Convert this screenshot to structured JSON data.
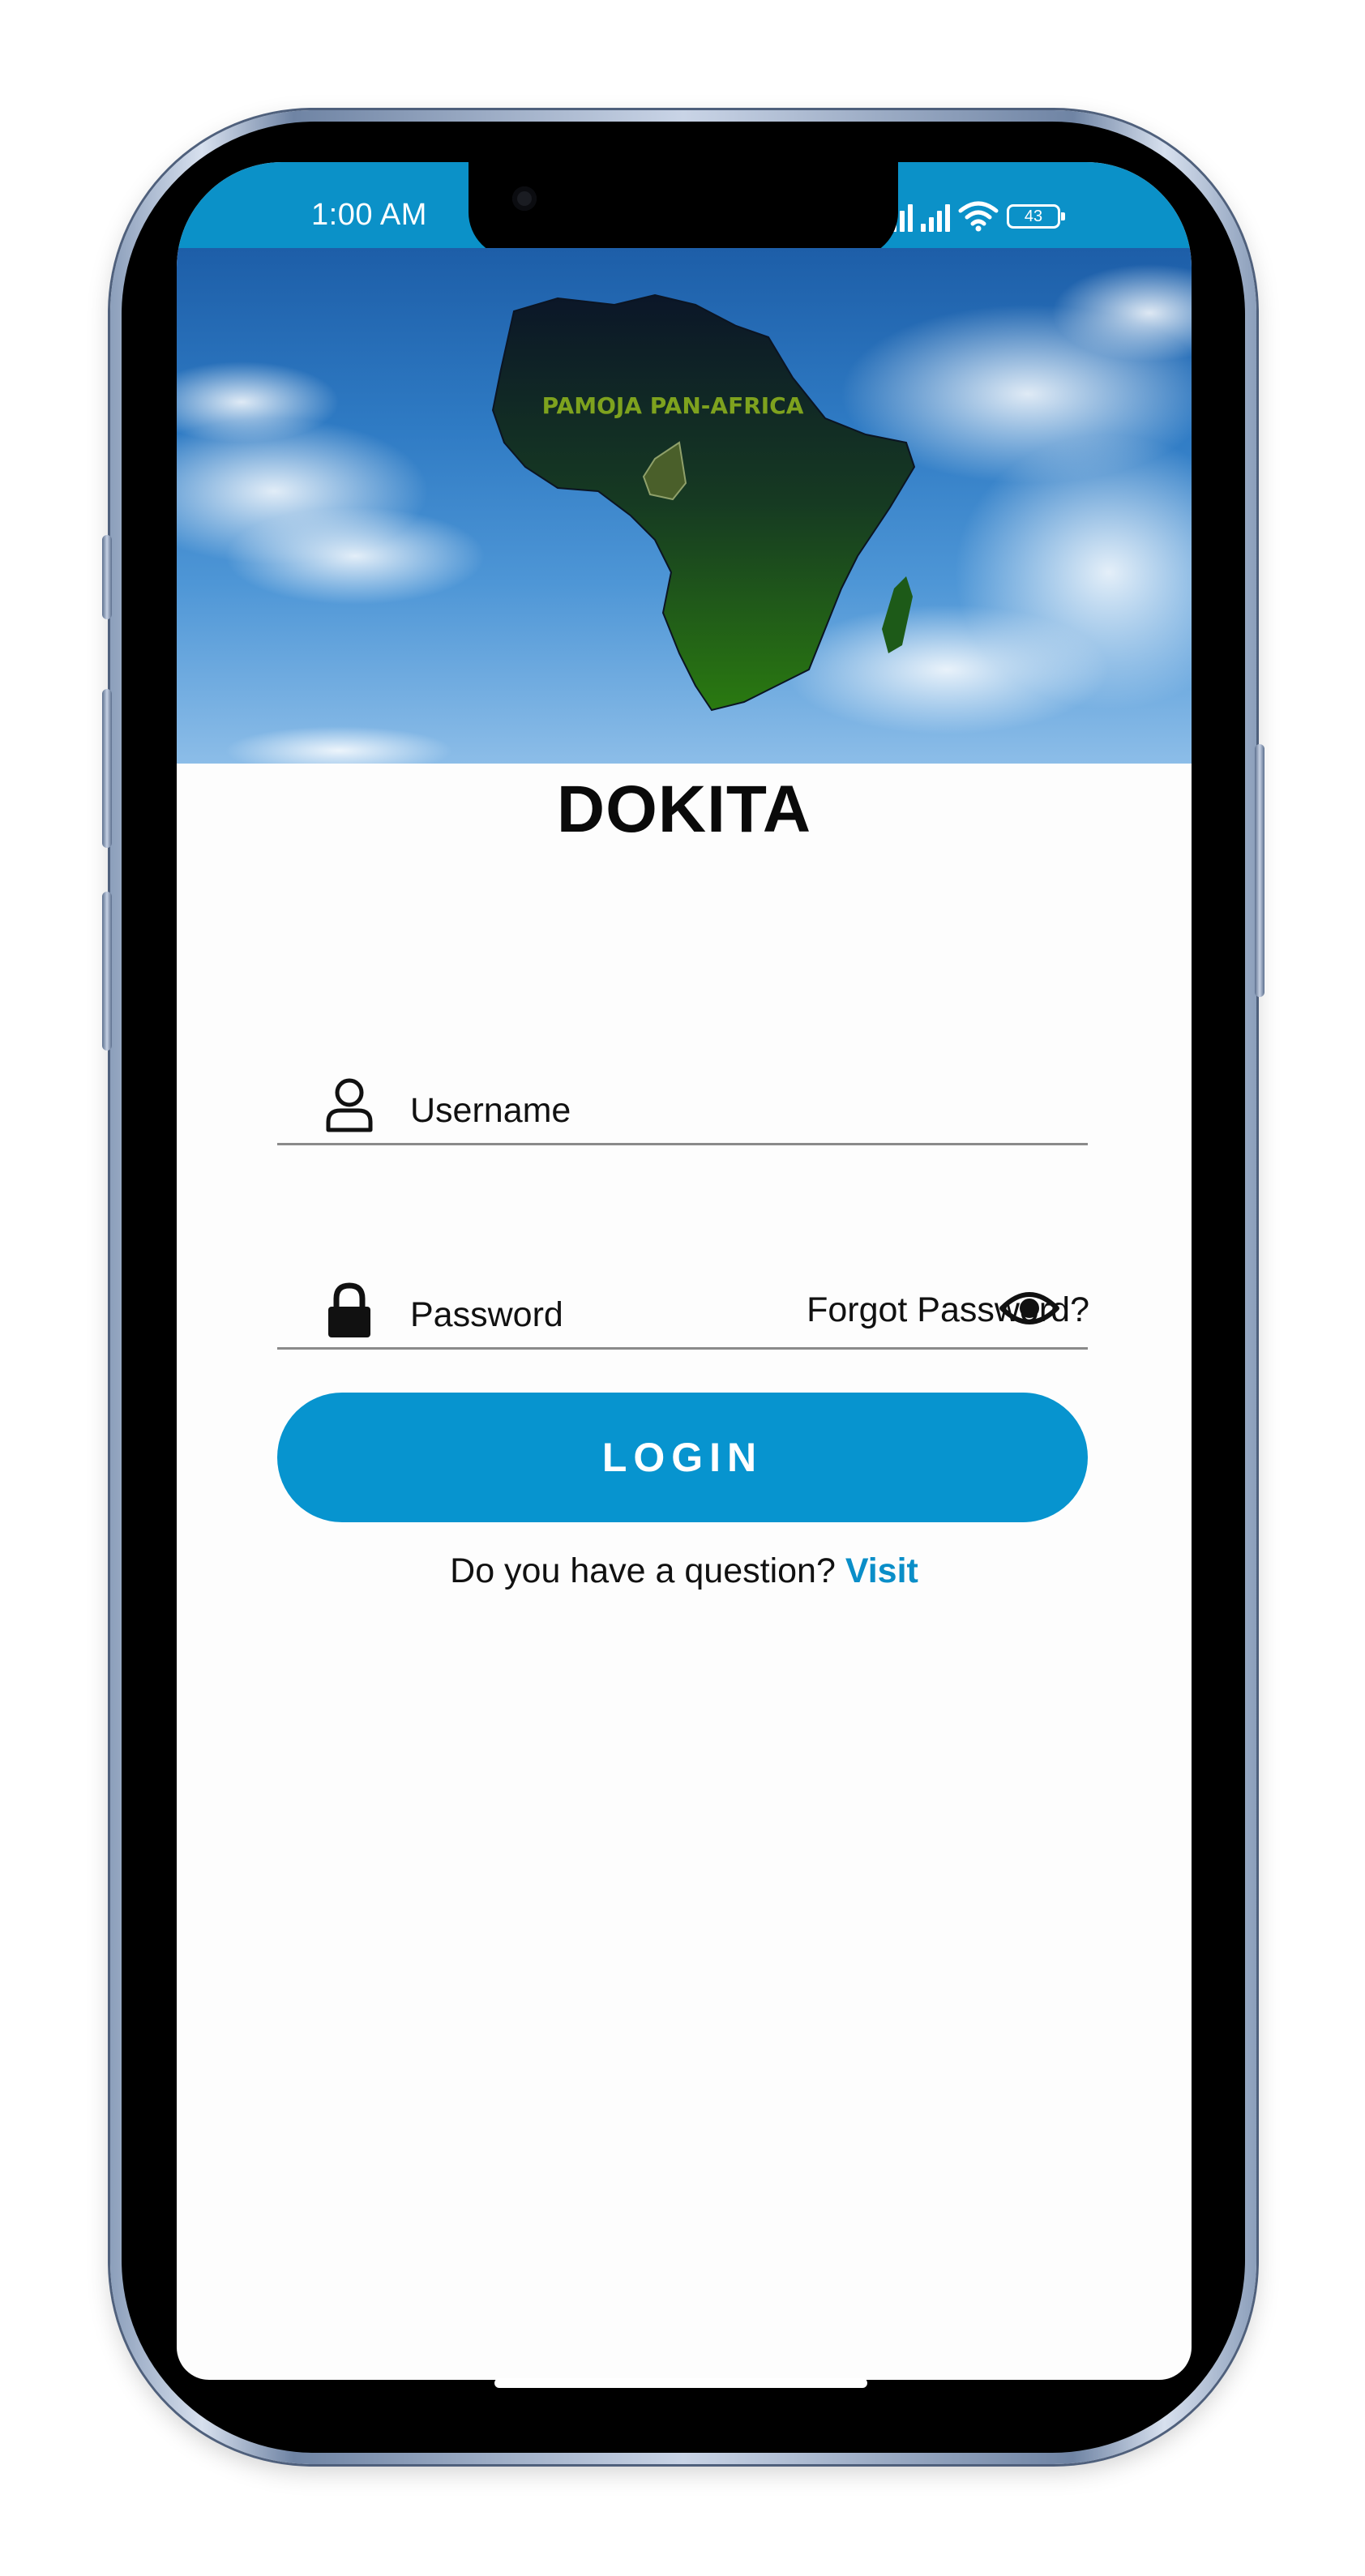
{
  "status_bar": {
    "time": "1:00 AM",
    "battery": "43",
    "icons": [
      "signal-icon",
      "signal-icon",
      "wifi-icon",
      "battery-icon"
    ]
  },
  "hero": {
    "logo_text": "PAMOJA PAN-AFRICA"
  },
  "app_title": "DOKITA",
  "login_form": {
    "username_placeholder": "Username",
    "password_placeholder": "Password",
    "forgot_password": "Forgot Password?",
    "login_button": "LOGIN",
    "question_text": "Do you have a question?",
    "visit_link": "Visit"
  },
  "colors": {
    "accent": "#0794cf",
    "status_bar": "#0b91c8",
    "link": "#0a8ec8"
  }
}
